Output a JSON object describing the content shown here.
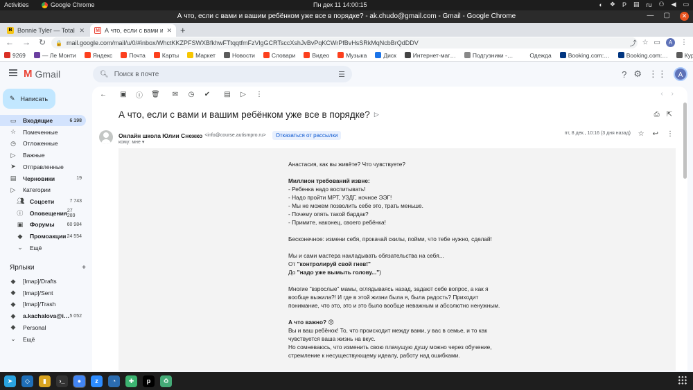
{
  "system": {
    "activities": "Activities",
    "app_name": "Google Chrome",
    "clock": "Пн дек 11  14:00:15",
    "lang": "ru"
  },
  "window": {
    "title": "А что, если с вами и вашим ребёнком уже все в порядке? - ak.chudo@gmail.com - Gmail - Google Chrome"
  },
  "tabs": [
    {
      "label": "Bonnie Tyler — Total Ecli"
    },
    {
      "label": "А что, если с вами и ваш"
    }
  ],
  "omnibox": {
    "url": "mail.google.com/mail/u/0/#inbox/WhctKKZPFSWXBfkhwFTtqqtfmFzVlgGCRTsccXshJvBvPqKCWrPfBvHsSRkMqNcbBrQdDDV"
  },
  "bookmarks": [
    {
      "label": "9269",
      "icon": "#d93025"
    },
    {
      "label": "— Ле Монти",
      "icon": "#6b3fa0"
    },
    {
      "label": "Яндекс",
      "icon": "#fc3f1d"
    },
    {
      "label": "Почта",
      "icon": "#fc3f1d"
    },
    {
      "label": "Карты",
      "icon": "#fc3f1d"
    },
    {
      "label": "Маркет",
      "icon": "#f7c600"
    },
    {
      "label": "Новости",
      "icon": "#5b5b5b"
    },
    {
      "label": "Словари",
      "icon": "#fc3f1d"
    },
    {
      "label": "Видео",
      "icon": "#fc3f1d"
    },
    {
      "label": "Музыка",
      "icon": "#fc3f1d"
    },
    {
      "label": "Диск",
      "icon": "#1a73e8"
    },
    {
      "label": "Интернет-маг…",
      "icon": "#444"
    },
    {
      "label": "Подгузники -…",
      "icon": "#888"
    },
    {
      "label": "Одежда",
      "icon": "#fff"
    },
    {
      "label": "Booking.com:…",
      "icon": "#003580"
    },
    {
      "label": "Booking.com:…",
      "icon": "#003580"
    },
    {
      "label": "Курортный от…",
      "icon": "#5b5b5b"
    }
  ],
  "gmail": {
    "logo_text": "Gmail",
    "search_placeholder": "Поиск в почте",
    "avatar_letter": "A",
    "compose_label": "Написать"
  },
  "sidebar": {
    "items": [
      {
        "label": "Входящие",
        "count": "6 198",
        "icon": "inbox-icon"
      },
      {
        "label": "Помеченные",
        "count": "",
        "icon": "star-icon"
      },
      {
        "label": "Отложенные",
        "count": "",
        "icon": "clock-icon"
      },
      {
        "label": "Важные",
        "count": "",
        "icon": "important-icon"
      },
      {
        "label": "Отправленные",
        "count": "",
        "icon": "send-icon"
      },
      {
        "label": "Черновики",
        "count": "19",
        "icon": "draft-icon"
      },
      {
        "label": "Категории",
        "count": "",
        "icon": "label-icon"
      },
      {
        "label": "Соцсети",
        "count": "7 743",
        "icon": "people-icon"
      },
      {
        "label": "Оповещения",
        "count": "27 289",
        "icon": "info-icon"
      },
      {
        "label": "Форумы",
        "count": "60 984",
        "icon": "forum-icon"
      },
      {
        "label": "Промоакции",
        "count": "24 554",
        "icon": "tag-icon"
      },
      {
        "label": "Ещё",
        "count": "",
        "icon": "chevron-down-icon"
      }
    ],
    "labels_header": "Ярлыки",
    "labels": [
      {
        "label": "[Imap]/Drafts",
        "count": ""
      },
      {
        "label": "[Imap]/Sent",
        "count": ""
      },
      {
        "label": "[Imap]/Trash",
        "count": ""
      },
      {
        "label": "a.kachalova@i…",
        "count": "5 052"
      },
      {
        "label": "Personal",
        "count": ""
      },
      {
        "label": "Ещё",
        "count": ""
      }
    ]
  },
  "message": {
    "subject": "А что, если с вами и вашим ребёнком уже все в порядке?",
    "sender_name": "Онлайн школа Юлии Снежко",
    "sender_email": "<info@course.autismpro.ru>",
    "unsubscribe": "Отказаться от рассылки",
    "to": "кому: мне",
    "date": "пт, 8 дек., 10:16 (3 дня назад)",
    "body": {
      "greeting": "Анастасия, как вы живёте? Что чувствуете?",
      "demands_title": "Миллион требований извне:",
      "demands": [
        "- Ребенка надо воспитывать!",
        "- Надо пройти МРТ, УЗДГ, ночное ЭЭГ!",
        "- Мы не можем позволить себе это, трать меньше.",
        "- Почему опять такой бардак?",
        "- Примите, наконец, своего ребёнка!"
      ],
      "endless": "Бесконечное: измени себя, прокачай скилы, пойми, что тебе нужно, сделай!",
      "masters": "Мы и сами мастера накладывать обязательства на себя...",
      "from_prefix": "От ",
      "from_bold": "\"контролируй свой гнев!\"",
      "to_prefix": "До ",
      "to_bold": "\"надо уже вымыть голову...\"",
      "to_suffix": ")",
      "adults": "Многие \"взрослые\" мамы, оглядываясь назад,  задают себе вопрос, а как я вообще выжила?! И где в этой жизни была я, была радость? Приходит понимание, что это, это и это было вообще неважным и абсолютно ненужным.",
      "important_title": "А что важно?",
      "important_emoji": "😞",
      "important_1": "Вы и ваш ребёнок! То, что происходит между вами, у вас в семье, и то как чувствуется ваша жизнь на вкус.",
      "important_2": "Но сомневаюсь, что изменить свою плачущую душу можно через обучение, стремление к несуществующему идеалу, работу над ошибками."
    }
  },
  "dock": [
    {
      "name": "telegram",
      "color": "#2aa3e0",
      "glyph": "➤"
    },
    {
      "name": "vscode",
      "color": "#1f6fb8",
      "glyph": "◇"
    },
    {
      "name": "notes",
      "color": "#d9a420",
      "glyph": "▮"
    },
    {
      "name": "terminal",
      "color": "#333",
      "glyph": "›_"
    },
    {
      "name": "chrome",
      "color": "#4285f4",
      "glyph": "●"
    },
    {
      "name": "zoom",
      "color": "#2d8cff",
      "glyph": "z"
    },
    {
      "name": "timer",
      "color": "#2b6cb0",
      "glyph": "◔"
    },
    {
      "name": "slack",
      "color": "#3cb371",
      "glyph": "✚"
    },
    {
      "name": "pycharm-p",
      "color": "#000",
      "glyph": "p"
    },
    {
      "name": "trash",
      "color": "#4a7",
      "glyph": "♻"
    }
  ]
}
